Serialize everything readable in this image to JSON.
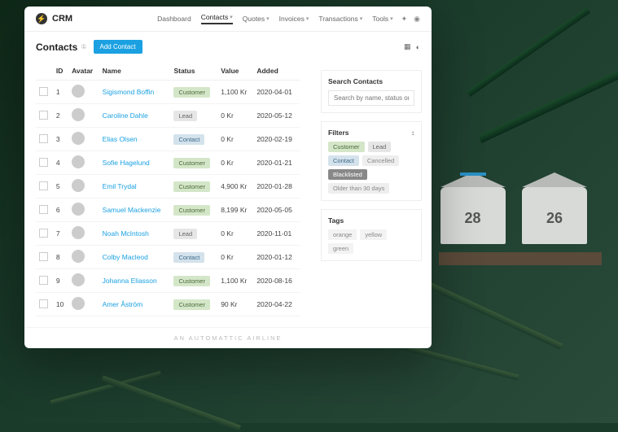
{
  "brand": "CRM",
  "nav": [
    {
      "label": "Dashboard",
      "active": false,
      "caret": false
    },
    {
      "label": "Contacts",
      "active": true,
      "caret": true
    },
    {
      "label": "Quotes",
      "active": false,
      "caret": true
    },
    {
      "label": "Invoices",
      "active": false,
      "caret": true
    },
    {
      "label": "Transactions",
      "active": false,
      "caret": true
    },
    {
      "label": "Tools",
      "active": false,
      "caret": true
    }
  ],
  "page": {
    "title": "Contacts",
    "add_button": "Add Contact"
  },
  "columns": [
    "ID",
    "Avatar",
    "Name",
    "Status",
    "Value",
    "Added"
  ],
  "rows": [
    {
      "id": "1",
      "name": "Sigismond Boffin",
      "status": "Customer",
      "status_class": "s-customer",
      "value": "1,100 Kr",
      "added": "2020-04-01"
    },
    {
      "id": "2",
      "name": "Caroline Dahle",
      "status": "Lead",
      "status_class": "s-lead",
      "value": "0 Kr",
      "added": "2020-05-12"
    },
    {
      "id": "3",
      "name": "Elias Olsen",
      "status": "Contact",
      "status_class": "s-contact",
      "value": "0 Kr",
      "added": "2020-02-19"
    },
    {
      "id": "4",
      "name": "Sofie Hagelund",
      "status": "Customer",
      "status_class": "s-customer",
      "value": "0 Kr",
      "added": "2020-01-21"
    },
    {
      "id": "5",
      "name": "Emil Trydal",
      "status": "Customer",
      "status_class": "s-customer",
      "value": "4,900 Kr",
      "added": "2020-01-28"
    },
    {
      "id": "6",
      "name": "Samuel Mackenzie",
      "status": "Customer",
      "status_class": "s-customer",
      "value": "8,199 Kr",
      "added": "2020-05-05"
    },
    {
      "id": "7",
      "name": "Noah McIntosh",
      "status": "Lead",
      "status_class": "s-lead",
      "value": "0 Kr",
      "added": "2020-11-01"
    },
    {
      "id": "8",
      "name": "Colby Macleod",
      "status": "Contact",
      "status_class": "s-contact",
      "value": "0 Kr",
      "added": "2020-01-12"
    },
    {
      "id": "9",
      "name": "Johanna Eliasson",
      "status": "Customer",
      "status_class": "s-customer",
      "value": "1,100 Kr",
      "added": "2020-08-16"
    },
    {
      "id": "10",
      "name": "Amer Åström",
      "status": "Customer",
      "status_class": "s-customer",
      "value": "90 Kr",
      "added": "2020-04-22"
    }
  ],
  "search": {
    "title": "Search Contacts",
    "placeholder": "Search by name, status or ID"
  },
  "filters": {
    "title": "Filters",
    "toggle": "↕",
    "items": [
      {
        "label": "Customer",
        "cls": "ft-customer"
      },
      {
        "label": "Lead",
        "cls": "ft-lead"
      },
      {
        "label": "Contact",
        "cls": "ft-contact"
      },
      {
        "label": "Cancelled",
        "cls": "ft-cancelled"
      },
      {
        "label": "Blacklisted",
        "cls": "ft-blacklisted"
      },
      {
        "label": "Older than 30 days",
        "cls": "ft-older"
      }
    ]
  },
  "tags": {
    "title": "Tags",
    "items": [
      "orange",
      "yellow",
      "green"
    ]
  },
  "footer": "AN AUTOMATTIC AIRLINE",
  "mailboxes": [
    "28",
    "26"
  ]
}
